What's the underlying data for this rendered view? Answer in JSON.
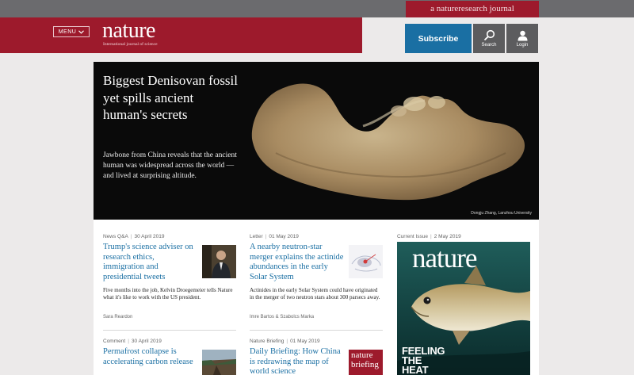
{
  "header": {
    "journal_tag": "a natureresearch journal",
    "menu_label": "MENU",
    "logo_text": "nature",
    "logo_subtitle": "International journal of science",
    "subscribe_label": "Subscribe",
    "search_label": "Search",
    "login_label": "Login"
  },
  "hero": {
    "title": "Biggest Denisovan fossil yet spills ancient human's secrets",
    "description": "Jawbone from China reveals that the ancient human was widespread across the world — and lived at surprising altitude.",
    "credit": "Dongju Zhang, Lanzhou University"
  },
  "cards": [
    {
      "type": "News Q&A",
      "date": "30 April 2019",
      "title": "Trump's science adviser on research ethics, immigration and presidential tweets",
      "body": "Five months into the job, Kelvin Droegemeier tells Nature what it's like to work with the US president.",
      "author": "Sara Reardon"
    },
    {
      "type": "Letter",
      "date": "01 May 2019",
      "title": "A nearby neutron-star merger explains the actinide abundances in the early Solar System",
      "body": "Actinides in the early Solar System could have originated in the merger of two neutron stars about 300 parsecs away.",
      "author": "Imre Bartos & Szabolcs Marka"
    },
    {
      "type": "Comment",
      "date": "30 April 2019",
      "title": "Permafrost collapse is accelerating carbon release"
    },
    {
      "type": "Nature Briefing",
      "date": "01 May 2019",
      "title": "Daily Briefing: How China is redrawing the map of world science",
      "thumb_text": "nature briefing"
    }
  ],
  "current_issue": {
    "label": "Current Issue",
    "date": "2 May 2019",
    "cover_title": "nature",
    "cover_headline": "FEELING THE HEAT"
  },
  "colors": {
    "brand_red": "#9d1a2c",
    "link_blue": "#1a6fa3",
    "subscribe_blue": "#1a6fa3"
  }
}
